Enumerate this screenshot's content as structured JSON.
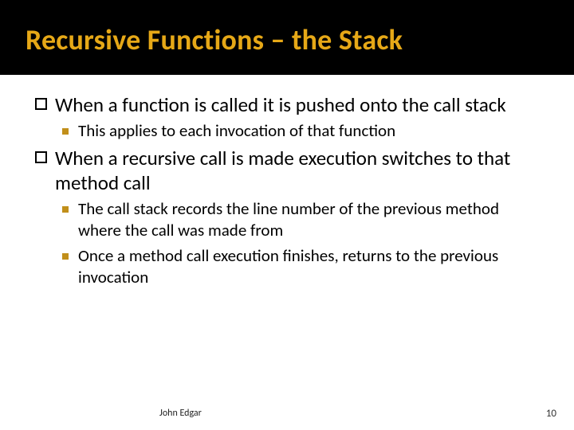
{
  "title": "Recursive Functions – the Stack",
  "bullets": [
    {
      "level": 1,
      "text": "When a function is called it is pushed onto the call stack"
    },
    {
      "level": 2,
      "text": "This applies to each invocation of that function"
    },
    {
      "level": 1,
      "text": "When a recursive call is made execution switches to that method call"
    },
    {
      "level": 2,
      "text": "The call stack records the line number of the previous method where the call was made from"
    },
    {
      "level": 2,
      "text": "Once a method call execution finishes, returns to the previous invocation"
    }
  ],
  "footer": {
    "author": "John Edgar",
    "page": "10"
  }
}
